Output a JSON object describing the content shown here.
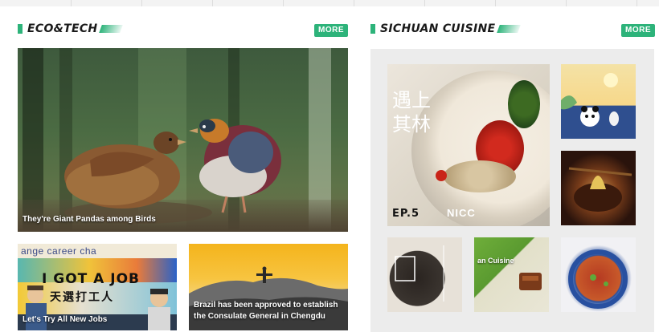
{
  "eco": {
    "title": "ECO&TECH",
    "more_label": "MORE",
    "featured": {
      "caption": "They're Giant Pandas among Birds"
    },
    "cards": [
      {
        "caption": "Let's Try All New Jobs",
        "poster_text": "I GOT A JOB",
        "poster_cn": "天選打工人",
        "poster_top": "ange  career cha"
      },
      {
        "caption": "Brazil has been approved to establish the Consulate General in Chengdu"
      }
    ]
  },
  "sichuan": {
    "title": "SICHUAN CUISINE",
    "more_label": "MORE",
    "featured": {
      "episode": "EP.5",
      "brand": "NICC",
      "cn_title": "遇上\n其林"
    },
    "thumbs": [
      {
        "label": ""
      },
      {
        "label": ""
      },
      {
        "label": ""
      },
      {
        "label": "an Cuisine"
      },
      {
        "label": ""
      }
    ]
  },
  "colors": {
    "accent": "#2db37a"
  }
}
